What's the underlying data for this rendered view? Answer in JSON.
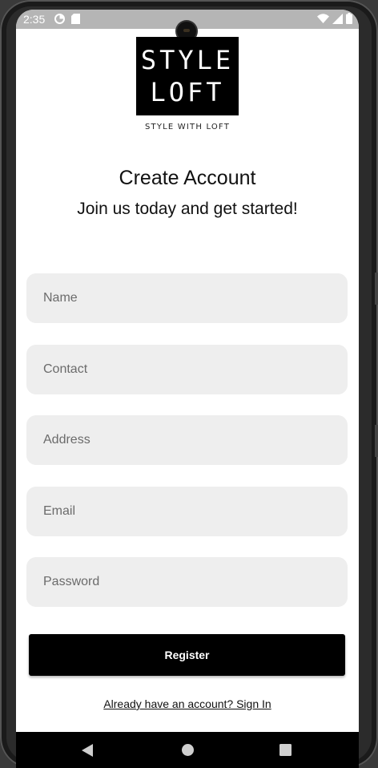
{
  "status_bar": {
    "time": "2:35",
    "left_icons": [
      "data-saver-icon",
      "sim-card-icon"
    ],
    "right_icons": [
      "wifi-icon",
      "signal-icon",
      "battery-icon"
    ]
  },
  "logo": {
    "line1": "STYLE",
    "line2": "LOFT",
    "tagline": "STYLE WITH LOFT"
  },
  "header": {
    "title": "Create Account",
    "subtitle": "Join us today and get started!"
  },
  "form": {
    "name_placeholder": "Name",
    "contact_placeholder": "Contact",
    "address_placeholder": "Address",
    "email_placeholder": "Email",
    "password_placeholder": "Password",
    "name_value": "",
    "contact_value": "",
    "address_value": "",
    "email_value": "",
    "password_value": ""
  },
  "actions": {
    "register_label": "Register",
    "signin_link": "Already have an account? Sign In"
  },
  "nav": {
    "back": "back-icon",
    "home": "home-icon",
    "recents": "recents-icon"
  },
  "colors": {
    "field_bg": "#eeeeee",
    "button_bg": "#000000",
    "status_bar_bg": "#b5b5b5"
  }
}
